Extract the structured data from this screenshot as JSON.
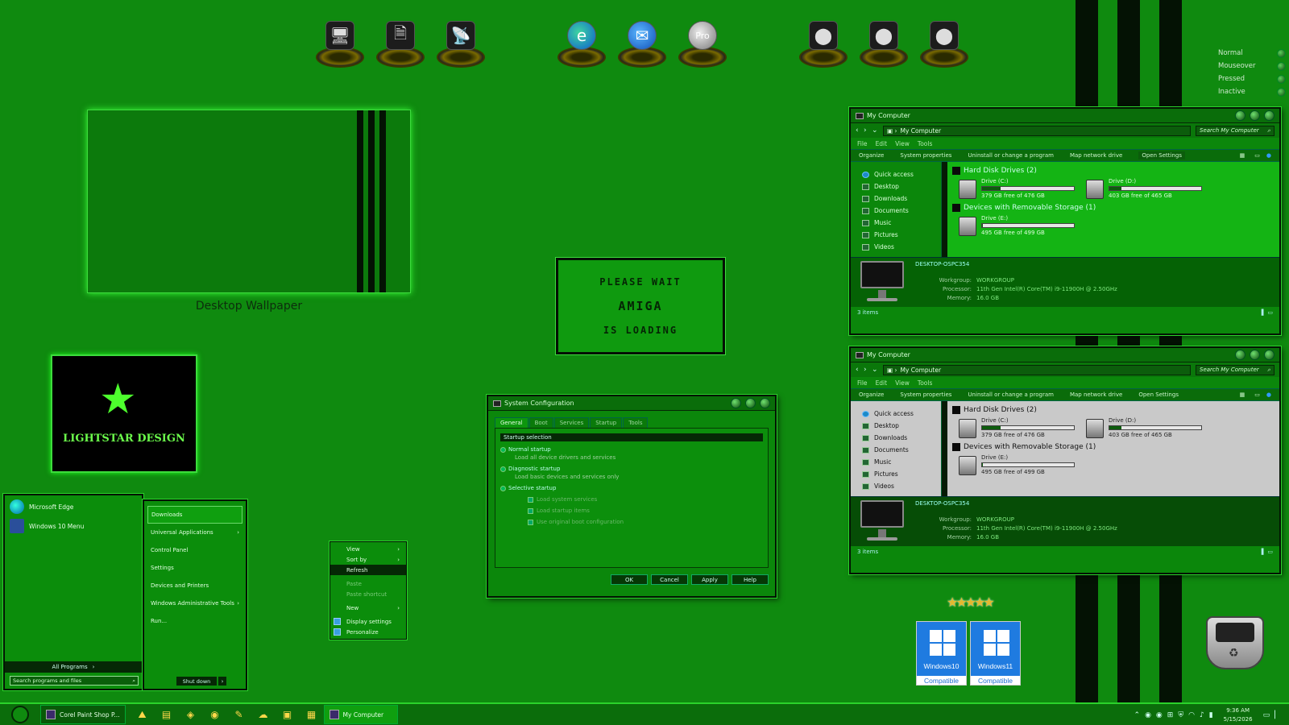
{
  "legend": {
    "items": [
      "Normal",
      "Mouseover",
      "Pressed",
      "Inactive"
    ]
  },
  "dock": {
    "group1": [
      "computer-icon",
      "documents-icon",
      "network-icon"
    ],
    "group2": [
      "edge-icon",
      "thunderbird-icon",
      "google-earth-pro-icon"
    ],
    "google_earth_label": "Pro",
    "group3": [
      "drive-icon",
      "drive-icon",
      "drive-icon"
    ]
  },
  "wallpaper": {
    "label": "Desktop Wallpaper"
  },
  "logo": {
    "text": "LIGHTSTAR DESIGN"
  },
  "amiga": {
    "line1": "PLEASE WAIT",
    "line2": "AMIGA",
    "line3": "IS LOADING"
  },
  "explorer": {
    "title": "My Computer",
    "address": "My Computer",
    "search_placeholder": "Search My Computer",
    "menu": [
      "File",
      "Edit",
      "View",
      "Tools"
    ],
    "commands": [
      "Organize",
      "System properties",
      "Uninstall or change a program",
      "Map network drive",
      "Open Settings"
    ],
    "nav": [
      "Quick access",
      "Desktop",
      "Downloads",
      "Documents",
      "Music",
      "Pictures",
      "Videos"
    ],
    "group_hdd": "Hard Disk Drives (2)",
    "group_removable": "Devices with Removable Storage (1)",
    "drives": [
      {
        "name": "Drive (C:)",
        "free": "379 GB free of 476 GB",
        "used_fraction": 0.2
      },
      {
        "name": "Drive (D:)",
        "free": "403 GB free of 465 GB",
        "used_fraction": 0.13
      },
      {
        "name": "Drive (E:)",
        "free": "495 GB free of 499 GB",
        "used_fraction": 0.01
      }
    ],
    "pc_name": "DESKTOP-OSPC354",
    "details": [
      {
        "k": "Workgroup:",
        "v": "WORKGROUP"
      },
      {
        "k": "Processor:",
        "v": "11th Gen Intel(R) Core(TM) i9-11900H @ 2.50GHz"
      },
      {
        "k": "Memory:",
        "v": "16.0 GB"
      }
    ],
    "status": "3 items"
  },
  "sysconfig": {
    "title": "System Configuration",
    "tabs": [
      "General",
      "Boot",
      "Services",
      "Startup",
      "Tools"
    ],
    "section": "Startup selection",
    "normal": "Normal startup",
    "normal_sub": "Load all device drivers and services",
    "diagnostic": "Diagnostic startup",
    "diagnostic_sub": "Load basic devices and services only",
    "selective": "Selective startup",
    "checks": [
      "Load system services",
      "Load startup items",
      "Use original boot configuration"
    ],
    "buttons": [
      "OK",
      "Cancel",
      "Apply",
      "Help"
    ]
  },
  "startmenu": {
    "left_items": [
      "Microsoft Edge",
      "Windows 10 Menu"
    ],
    "all_programs": "All Programs",
    "search_placeholder": "Search programs and files",
    "right_items": [
      "Downloads",
      "Universal Applications",
      "Control Panel",
      "Settings",
      "Devices and Printers",
      "Windows Administrative Tools",
      "Run..."
    ],
    "shutdown": "Shut down"
  },
  "context_menu": {
    "items": [
      "View",
      "Sort by",
      "Refresh",
      "Paste",
      "Paste shortcut",
      "New",
      "Display settings",
      "Personalize"
    ]
  },
  "badges": [
    {
      "name": "Windows10",
      "label": "Compatible"
    },
    {
      "name": "Windows11",
      "label": "Compatible"
    }
  ],
  "taskbar": {
    "tasks": [
      "Corel Paint Shop P...",
      "My Computer"
    ],
    "time": "9:36 AM",
    "date": "5/15/2026"
  }
}
